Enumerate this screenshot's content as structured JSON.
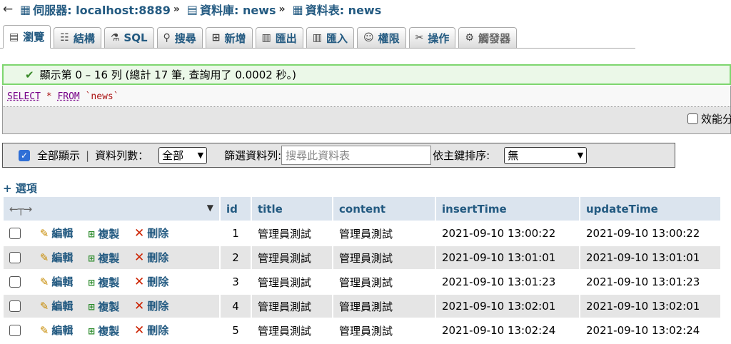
{
  "breadcrumb": {
    "back": "←",
    "server_label": "伺服器: localhost:8889",
    "db_label": "資料庫: news",
    "table_label": "資料表: news",
    "separator": "»"
  },
  "tabs": [
    {
      "label": "瀏覽",
      "icon": "browse-icon"
    },
    {
      "label": "結構",
      "icon": "structure-icon"
    },
    {
      "label": "SQL",
      "icon": "sql-icon"
    },
    {
      "label": "搜尋",
      "icon": "search-icon"
    },
    {
      "label": "新增",
      "icon": "insert-icon"
    },
    {
      "label": "匯出",
      "icon": "export-icon"
    },
    {
      "label": "匯入",
      "icon": "import-icon"
    },
    {
      "label": "權限",
      "icon": "privileges-icon"
    },
    {
      "label": "操作",
      "icon": "operations-icon"
    },
    {
      "label": "觸發器",
      "icon": "triggers-icon"
    }
  ],
  "success_message": "顯示第 0 – 16 列 (總計 17 筆, 查詢用了 0.0002 秒。)",
  "sql": {
    "select": "SELECT",
    "star": "*",
    "from": "FROM",
    "table": "`news`"
  },
  "profiling_label": "效能分",
  "navbar": {
    "show_all_label": "全部顯示",
    "divider": "|",
    "rows_label": "資料列數：",
    "rows_value": "全部",
    "filter_label": "篩選資料列:",
    "filter_placeholder": "搜尋此資料表",
    "sort_label": "依主鍵排序:",
    "sort_value": "無"
  },
  "options_label": "+ 選項",
  "table": {
    "headers": [
      "id",
      "title",
      "content",
      "insertTime",
      "updateTime"
    ],
    "action_labels": {
      "edit": "編輯",
      "copy": "複製",
      "delete": "刪除"
    },
    "rows": [
      [
        "1",
        "管理員測試",
        "管理員測試",
        "2021-09-10 13:00:22",
        "2021-09-10 13:00:22"
      ],
      [
        "2",
        "管理員測試",
        "管理員測試",
        "2021-09-10 13:01:01",
        "2021-09-10 13:01:01"
      ],
      [
        "3",
        "管理員測試",
        "管理員測試",
        "2021-09-10 13:01:23",
        "2021-09-10 13:01:23"
      ],
      [
        "4",
        "管理員測試",
        "管理員測試",
        "2021-09-10 13:02:01",
        "2021-09-10 13:02:01"
      ],
      [
        "5",
        "管理員測試",
        "管理員測試",
        "2021-09-10 13:02:24",
        "2021-09-10 13:02:24"
      ]
    ]
  },
  "colors": {
    "link": "#235a81",
    "success_border": "#7ed66f",
    "header_bg": "#dbe4ee"
  }
}
